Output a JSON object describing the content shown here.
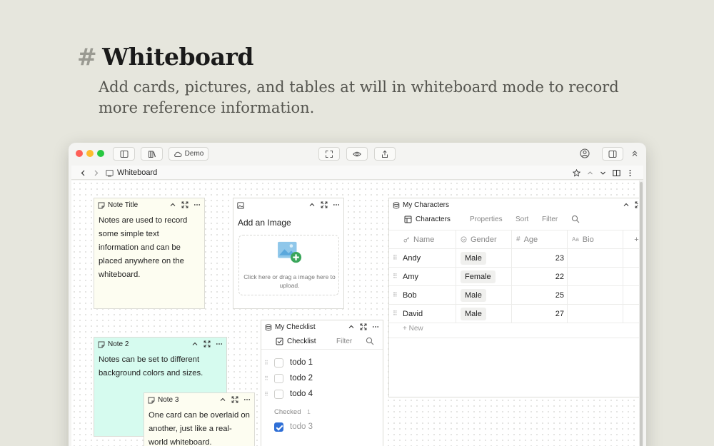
{
  "hero": {
    "hash": "#",
    "title": "Whiteboard",
    "subtitle": "Add cards, pictures, and tables at will in whiteboard mode to record more reference information."
  },
  "titlebar": {
    "workspace_label": "Demo"
  },
  "navbar": {
    "breadcrumb": "Whiteboard"
  },
  "note1": {
    "title": "Note Title",
    "body": "Notes are used to record some simple text information and can be placed anywhere on the whiteboard.",
    "bg": "#fdfdf1"
  },
  "image_card": {
    "title": "Add an Image",
    "hint": "Click here or drag a image here to upload."
  },
  "note2": {
    "title": "Note 2",
    "body": "Notes can be set to different background colors and sizes.",
    "bg": "#d6fbef"
  },
  "note3": {
    "title": "Note 3",
    "body": "One card can be overlaid on another, just like a real-world whiteboard.",
    "bg": "#fdfdf1"
  },
  "checklist": {
    "title": "My Checklist",
    "view_label": "Checklist",
    "filter_label": "Filter",
    "items": [
      "todo 1",
      "todo 2",
      "todo 4"
    ],
    "checked_header": "Checked",
    "checked_count": "1",
    "checked_items": [
      "todo 3"
    ]
  },
  "characters": {
    "title": "My Characters",
    "view_label": "Characters",
    "properties_label": "Properties",
    "sort_label": "Sort",
    "filter_label": "Filter",
    "columns": [
      "Name",
      "Gender",
      "Age",
      "Bio"
    ],
    "add_col": "+",
    "rows": [
      {
        "name": "Andy",
        "gender": "Male",
        "age": "23"
      },
      {
        "name": "Amy",
        "gender": "Female",
        "age": "22"
      },
      {
        "name": "Bob",
        "gender": "Male",
        "age": "25"
      },
      {
        "name": "David",
        "gender": "Male",
        "age": "27"
      }
    ],
    "new_label": "+ New"
  },
  "colors": {
    "accent": "#2f6fd6",
    "canvas": "#ffffff",
    "background": "#e6e6dd"
  }
}
